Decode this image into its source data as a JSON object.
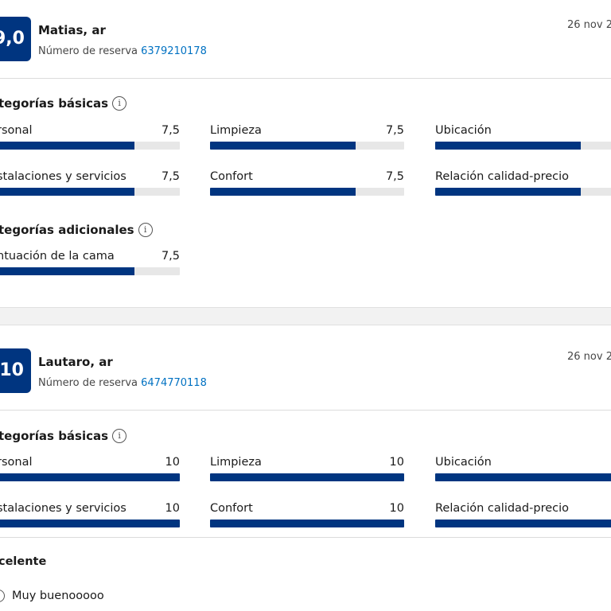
{
  "reviews": [
    {
      "score": "9,0",
      "guest": "Matias, ar",
      "reservation_label": "Número de reserva",
      "reservation_number": "6379210178",
      "date": "26 nov 2",
      "basic_title": "tegorías básicas",
      "basic_categories": [
        {
          "label": "rsonal",
          "value": "7,5",
          "fill": 0.75
        },
        {
          "label": "Limpieza",
          "value": "7,5",
          "fill": 0.75
        },
        {
          "label": "Ubicación",
          "value": "",
          "fill": 0.75
        },
        {
          "label": "stalaciones y servicios",
          "value": "7,5",
          "fill": 0.75
        },
        {
          "label": "Confort",
          "value": "7,5",
          "fill": 0.75
        },
        {
          "label": "Relación calidad-precio",
          "value": "",
          "fill": 0.75
        }
      ],
      "additional_title": "tegorías adicionales",
      "additional_categories": [
        {
          "label": "ntuación de la cama",
          "value": "7,5",
          "fill": 0.75
        }
      ]
    },
    {
      "score": "10",
      "guest": "Lautaro, ar",
      "reservation_label": "Número de reserva",
      "reservation_number": "6474770118",
      "date": "26 nov 2",
      "basic_title": "tegorías básicas",
      "basic_categories": [
        {
          "label": "rsonal",
          "value": "10",
          "fill": 1.0
        },
        {
          "label": "Limpieza",
          "value": "10",
          "fill": 1.0
        },
        {
          "label": "Ubicación",
          "value": "",
          "fill": 1.0
        },
        {
          "label": "stalaciones y servicios",
          "value": "10",
          "fill": 1.0
        },
        {
          "label": "Confort",
          "value": "10",
          "fill": 1.0
        },
        {
          "label": "Relación calidad-precio",
          "value": "",
          "fill": 1.0
        }
      ],
      "comment_title": "celente",
      "comment_text": "Muy buenooooo"
    }
  ],
  "icons": {
    "info": "info-icon",
    "comment": "comment-icon"
  },
  "colors": {
    "bar": "#003580",
    "track": "#e7e7e7",
    "link": "#0071c2",
    "badge": "#003580"
  }
}
